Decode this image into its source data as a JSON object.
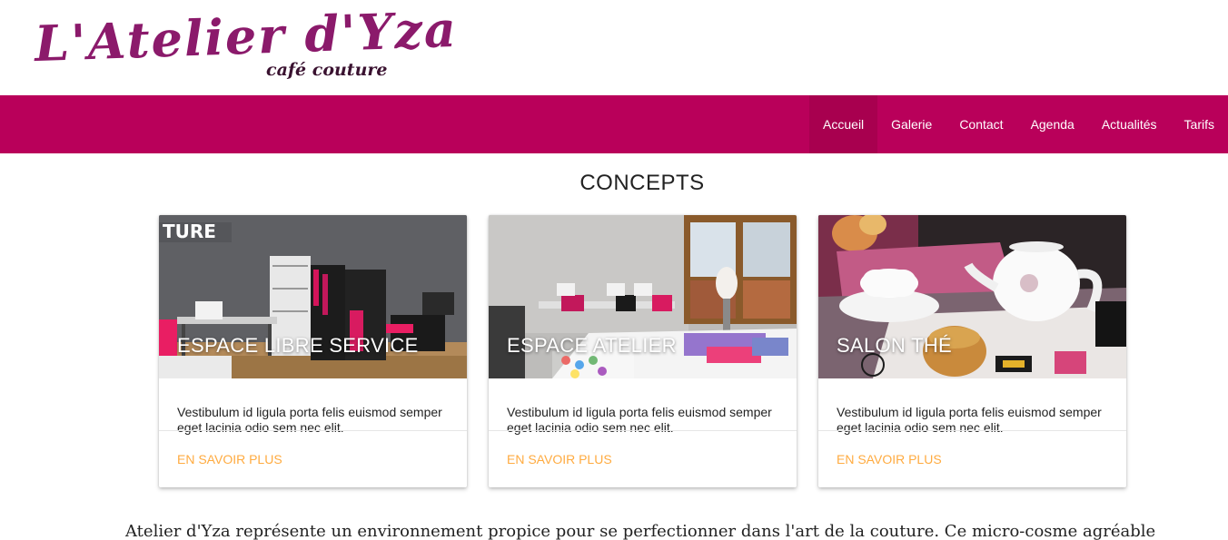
{
  "logo": {
    "name": "L'Atelier d'Yza",
    "tagline": "café couture",
    "color": "#8b1a6b"
  },
  "nav": {
    "color": "#b9005a",
    "items": [
      {
        "label": "Accueil",
        "active": true
      },
      {
        "label": "Galerie",
        "active": false
      },
      {
        "label": "Contact",
        "active": false
      },
      {
        "label": "Agenda",
        "active": false
      },
      {
        "label": "Actualités",
        "active": false
      },
      {
        "label": "Tarifs",
        "active": false
      }
    ]
  },
  "concepts": {
    "title": "CONCEPTS",
    "cards": [
      {
        "title": "ESPACE LIBRE SERVICE",
        "text": "Vestibulum id ligula porta felis euismod semper eget lacinia odio sem nec elit.",
        "link": "EN SAVOIR PLUS"
      },
      {
        "title": "ESPACE ATELIER",
        "text": "Vestibulum id ligula porta felis euismod semper eget lacinia odio sem nec elit.",
        "link": "EN SAVOIR PLUS"
      },
      {
        "title": "SALON THÉ",
        "text": "Vestibulum id ligula porta felis euismod semper eget lacinia odio sem nec elit.",
        "link": "EN SAVOIR PLUS"
      }
    ],
    "link_color": "#ffab40"
  },
  "intro": {
    "text": "Atelier d'Yza représente un environnement propice pour se perfectionner dans l'art de la couture. Ce micro-cosme agréable"
  }
}
